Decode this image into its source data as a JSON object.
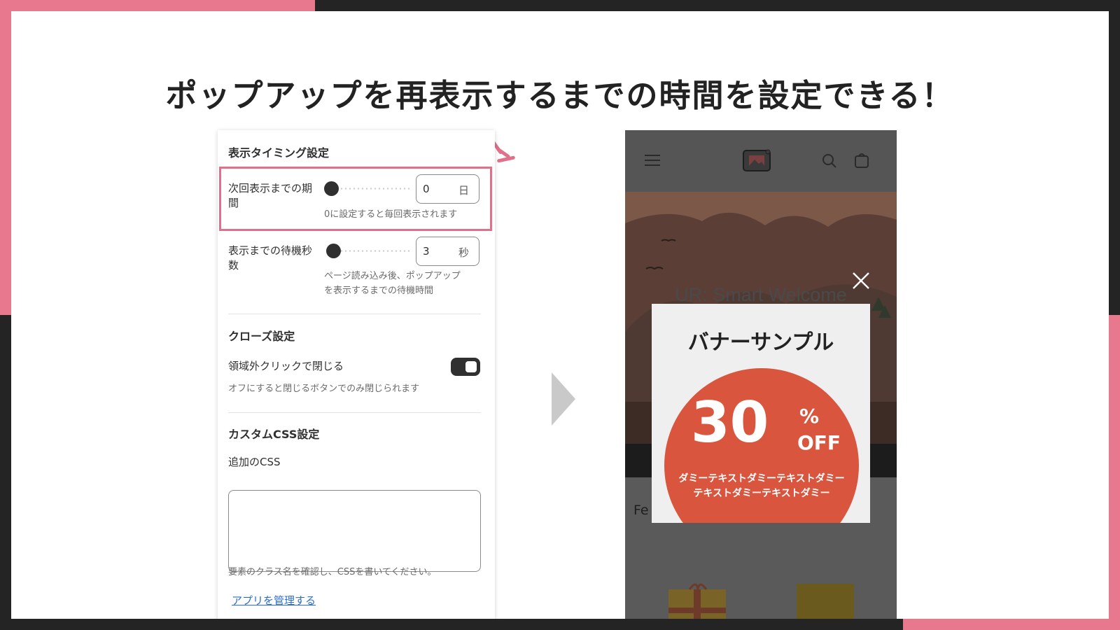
{
  "headline": "ポップアップを再表示するまでの時間を設定できる！",
  "panel": {
    "timing_title": "表示タイミング設定",
    "next_display": {
      "label_line1": "次回表示までの期",
      "label_line2": "間",
      "value": "0",
      "unit": "日",
      "help": "0に設定すると毎回表示されます",
      "slider_fraction": 0
    },
    "wait_seconds": {
      "label_line1": "表示までの待機秒",
      "label_line2": "数",
      "value": "3",
      "unit": "秒",
      "help_line1": "ページ読み込み後、ポップアップ",
      "help_line2": "を表示するまでの待機時間",
      "slider_fraction": 0.03
    },
    "close_title": "クローズ設定",
    "outside_click": {
      "label": "領域外クリックで閉じる",
      "help": "オフにすると閉じるボタンでのみ閉じられます",
      "enabled": true
    },
    "css_title": "カスタムCSS設定",
    "css_label": "追加のCSS",
    "css_value": "",
    "css_help": "要素のクラス名を確認し、CSSを書いてください。",
    "manage_link": "アプリを管理する"
  },
  "phone": {
    "store_title": "UR: Smart Welcome",
    "featured_partial": "Fe",
    "popup": {
      "title": "バナーサンプル",
      "big_number": "30",
      "percent": "%",
      "off": "OFF",
      "dummy_line1": "ダミーテキストダミーテキストダミー",
      "dummy_line2": "テキストダミーテキストダミー"
    }
  },
  "colors": {
    "accent_pink": "#e8788d",
    "popup_red": "#d9553d",
    "link_blue": "#2c6ecb"
  },
  "icons": [
    "menu-icon",
    "image-logo-icon",
    "search-icon",
    "cart-icon",
    "close-icon",
    "chevron-right-icon"
  ]
}
